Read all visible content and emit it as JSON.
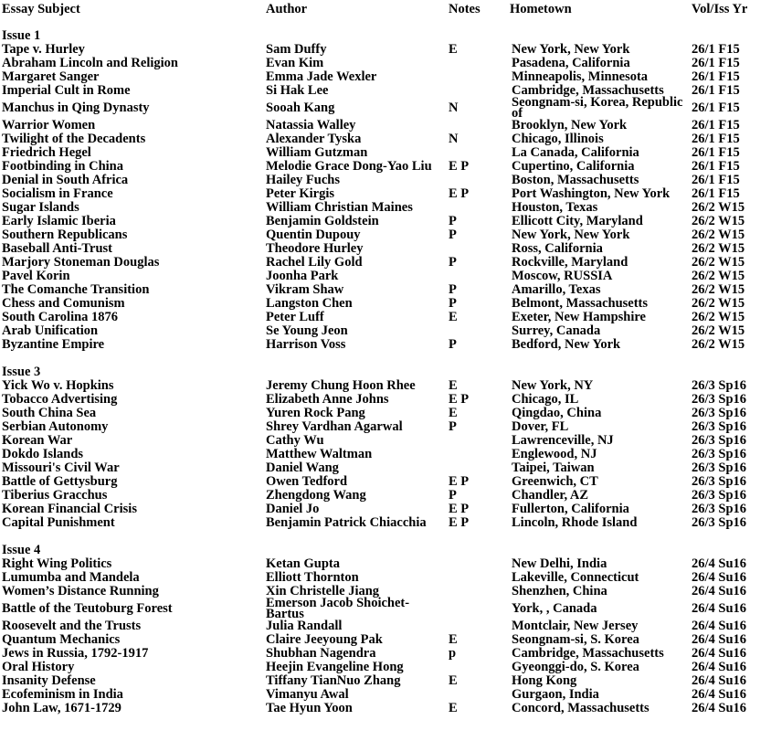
{
  "headers": [
    "Essay Subject",
    "Author",
    "Notes",
    "Hometown",
    "Vol/Iss Yr"
  ],
  "sections": [
    {
      "label": "Issue 1",
      "rows": [
        [
          "Tape v. Hurley",
          "Sam Duffy",
          "E",
          "New York, New York",
          "26/1 F15"
        ],
        [
          "Abraham Lincoln and Religion",
          "Evan Kim",
          "",
          "Pasadena, California",
          "26/1 F15"
        ],
        [
          "Margaret Sanger",
          "Emma Jade Wexler",
          "",
          "Minneapolis, Minnesota",
          "26/1 F15"
        ],
        [
          "Imperial Cult in Rome",
          "Si Hak Lee",
          "",
          "Cambridge, Massachusetts",
          "26/1 F15"
        ],
        [
          "Manchus in Qing Dynasty",
          "Sooah Kang",
          "N",
          "Seongnam-si, Korea, Republic of",
          "26/1 F15"
        ],
        [
          "Warrior Women",
          "Natassia Walley",
          "",
          "Brooklyn, New York",
          "26/1 F15"
        ],
        [
          "Twilight of the Decadents",
          "Alexander Tyska",
          "N",
          "Chicago, Illinois",
          "26/1 F15"
        ],
        [
          "Friedrich Hegel",
          "William Gutzman",
          "",
          "La Canada, California",
          "26/1 F15"
        ],
        [
          "Footbinding in China",
          "Melodie Grace Dong-Yao Liu",
          "E P",
          "Cupertino, California",
          "26/1 F15"
        ],
        [
          "Denial in South Africa",
          "Hailey Fuchs",
          "",
          "Boston, Massachusetts",
          "26/1 F15"
        ],
        [
          "Socialism in France",
          "Peter Kirgis",
          "E P",
          "Port Washington, New York",
          "26/1 F15"
        ],
        [
          "Sugar Islands",
          "William Christian Maines",
          "",
          "Houston, Texas",
          "26/2 W15"
        ],
        [
          "Early Islamic Iberia",
          "Benjamin Goldstein",
          "P",
          "Ellicott City, Maryland",
          "26/2 W15"
        ],
        [
          "Southern Republicans",
          "Quentin Dupouy",
          "P",
          "New York, New York",
          "26/2 W15"
        ],
        [
          "Baseball Anti-Trust",
          "Theodore Hurley",
          "",
          "Ross, California",
          "26/2 W15"
        ],
        [
          "Marjory Stoneman Douglas",
          "Rachel Lily Gold",
          "P",
          "Rockville, Maryland",
          "26/2 W15"
        ],
        [
          "Pavel Korin",
          "Joonha Park",
          "",
          "Moscow, RUSSIA",
          "26/2 W15"
        ],
        [
          "The Comanche Transition",
          "Vikram Shaw",
          "P",
          "Amarillo, Texas",
          "26/2 W15"
        ],
        [
          "Chess and Comunism",
          "Langston Chen",
          "P",
          "Belmont, Massachusetts",
          "26/2 W15"
        ],
        [
          "South Carolina 1876",
          "Peter Luff",
          "E",
          "Exeter, New Hampshire",
          "26/2 W15"
        ],
        [
          "Arab Unification",
          "Se Young Jeon",
          "",
          "Surrey, Canada",
          "26/2 W15"
        ],
        [
          "Byzantine Empire",
          "Harrison Voss",
          "P",
          "Bedford, New York",
          "26/2 W15"
        ]
      ]
    },
    {
      "label": "Issue 3",
      "rows": [
        [
          "Yick Wo v. Hopkins",
          "Jeremy Chung Hoon Rhee",
          "E",
          "New York, NY",
          "26/3 Sp16"
        ],
        [
          "Tobacco Advertising",
          "Elizabeth Anne Johns",
          "E P",
          "Chicago, IL",
          "26/3 Sp16"
        ],
        [
          "South China Sea",
          "Yuren Rock Pang",
          "E",
          "Qingdao, China",
          "26/3 Sp16"
        ],
        [
          "Serbian Autonomy",
          "Shrey Vardhan Agarwal",
          "P",
          "Dover, FL",
          "26/3 Sp16"
        ],
        [
          "Korean War",
          "Cathy Wu",
          "",
          "Lawrenceville, NJ",
          "26/3 Sp16"
        ],
        [
          "Dokdo Islands",
          "Matthew Waltman",
          "",
          "Englewood, NJ",
          "26/3 Sp16"
        ],
        [
          "Missouri's Civil War",
          "Daniel Wang",
          "",
          "Taipei, Taiwan",
          "26/3 Sp16"
        ],
        [
          "Battle of Gettysburg",
          "Owen Tedford",
          "E P",
          "Greenwich, CT",
          "26/3 Sp16"
        ],
        [
          "Tiberius Gracchus",
          "Zhengdong Wang",
          "P",
          "Chandler, AZ",
          "26/3 Sp16"
        ],
        [
          "Korean Financial Crisis",
          "Daniel Jo",
          "E P",
          "Fullerton, California",
          "26/3 Sp16"
        ],
        [
          "Capital Punishment",
          "Benjamin Patrick Chiacchia",
          "E P",
          "Lincoln, Rhode Island",
          "26/3 Sp16"
        ]
      ]
    },
    {
      "label": "Issue 4",
      "rows": [
        [
          "Right Wing Politics",
          "Ketan Gupta",
          "",
          "New Delhi, India",
          "26/4 Su16"
        ],
        [
          "Lumumba and Mandela",
          "Elliott Thornton",
          "",
          "Lakeville, Connecticut",
          "26/4 Su16"
        ],
        [
          "Women’s Distance Running",
          "Xin Christelle Jiang",
          "",
          "Shenzhen, China",
          "26/4 Su16"
        ],
        [
          "Battle of the Teutoburg Forest",
          "Emerson Jacob Shoichet-Bartus",
          "",
          "York, , Canada",
          "26/4 Su16"
        ],
        [
          "Roosevelt and the Trusts",
          "Julia Randall",
          "",
          "Montclair, New Jersey",
          "26/4 Su16"
        ],
        [
          "Quantum Mechanics",
          "Claire Jeeyoung Pak",
          "E",
          "Seongnam-si, S. Korea",
          "26/4 Su16"
        ],
        [
          "Jews in Russia, 1792-1917",
          "Shubhan Nagendra",
          "p",
          "Cambridge, Massachusetts",
          "26/4 Su16"
        ],
        [
          "Oral History",
          "Heejin Evangeline Hong",
          "",
          "Gyeonggi-do, S. Korea",
          "26/4 Su16"
        ],
        [
          "Insanity Defense",
          "Tiffany TianNuo Zhang",
          "E",
          "Hong Kong",
          "26/4 Su16"
        ],
        [
          "Ecofeminism in India",
          "Vimanyu Awal",
          "",
          "Gurgaon, India",
          "26/4 Su16"
        ],
        [
          "John Law, 1671-1729",
          "Tae Hyun Yoon",
          "E",
          "Concord, Massachusetts",
          "26/4 Su16"
        ]
      ]
    }
  ]
}
